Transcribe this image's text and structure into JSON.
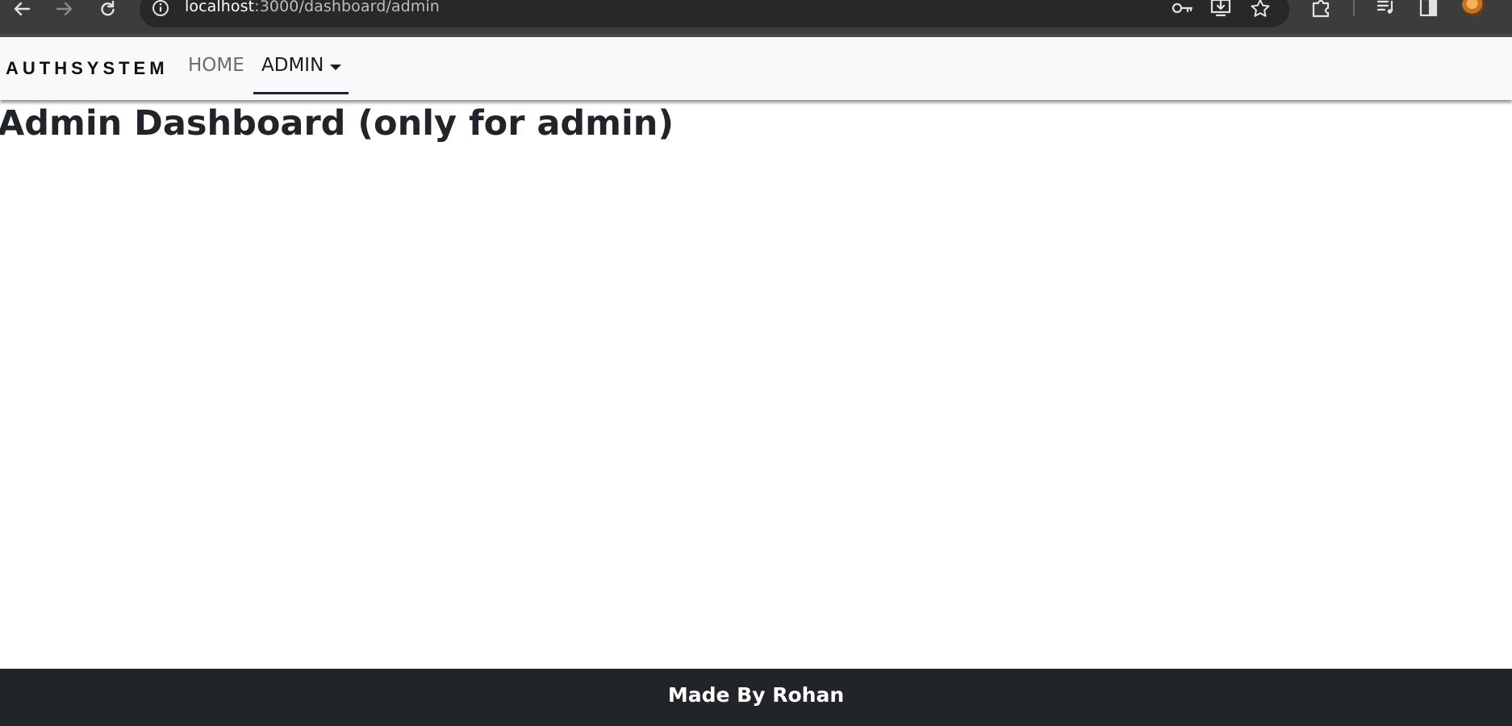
{
  "browser": {
    "url_host": "localhost",
    "url_path": ":3000/dashboard/admin",
    "icons": [
      "back-arrow-icon",
      "forward-arrow-icon",
      "reload-icon",
      "site-info-icon",
      "key-icon",
      "install-app-icon",
      "star-icon",
      "extensions-icon",
      "media-control-icon",
      "side-panel-icon",
      "profile-avatar-icon"
    ]
  },
  "navbar": {
    "brand": "AUTHSYSTEM",
    "links": [
      {
        "label": "HOME"
      },
      {
        "label": "ADMIN",
        "active": true,
        "has_dropdown": true
      }
    ]
  },
  "main": {
    "title": "Admin Dashboard (only for admin)"
  },
  "footer": {
    "text": "Made By Rohan"
  },
  "colors": {
    "navbar_bg": "#f8f9fa",
    "footer_bg": "#212529",
    "text_dark": "#212529",
    "nav_link_muted": "#6c6c6c",
    "browser_chrome": "#3c3c3c"
  }
}
